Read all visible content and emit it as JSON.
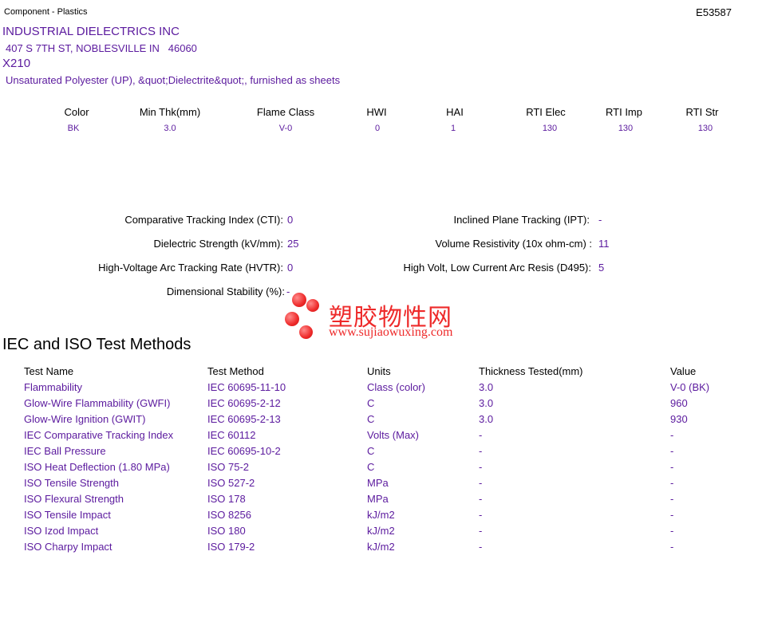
{
  "header": {
    "category": "Component - Plastics",
    "file_number": "E53587",
    "company": "INDUSTRIAL DIELECTRICS INC",
    "address": "407 S 7TH ST, NOBLESVILLE IN   46060",
    "grade": "X210",
    "description": "Unsaturated Polyester (UP), &quot;Dielectrite&quot;, furnished as sheets"
  },
  "summary": {
    "headers": [
      "Color",
      "Min Thk(mm)",
      "Flame Class",
      "HWI",
      "HAI",
      "RTI Elec",
      "RTI Imp",
      "RTI Str"
    ],
    "values": [
      "BK",
      "3.0",
      "V-0",
      "0",
      "1",
      "130",
      "130",
      "130"
    ]
  },
  "properties": {
    "cti_label": "Comparative Tracking Index (CTI):",
    "cti_value": "0",
    "ipt_label": "Inclined Plane Tracking (IPT):",
    "ipt_value": "-",
    "ds_label": "Dielectric Strength (kV/mm):",
    "ds_value": "25",
    "vr_label": "Volume Resistivity (10x ohm-cm) :",
    "vr_value": "11",
    "hvtr_label": "High-Voltage Arc Tracking Rate (HVTR):",
    "hvtr_value": "0",
    "d495_label": "High Volt, Low Current Arc Resis (D495):",
    "d495_value": "5",
    "dim_label": "Dimensional Stability (%):",
    "dim_value": "-"
  },
  "watermark": {
    "cn_text": "塑胶物性网",
    "url_text": "www.sujiaowuxing.com",
    "color": "#ee2a2a"
  },
  "test_section": {
    "title": "IEC and ISO Test Methods",
    "columns": [
      "Test Name",
      "Test Method",
      "Units",
      "Thickness Tested(mm)",
      "Value"
    ],
    "rows": [
      [
        "Flammability",
        "IEC 60695-11-10",
        "Class (color)",
        "3.0",
        "V-0 (BK)"
      ],
      [
        "Glow-Wire Flammability (GWFI)",
        "IEC 60695-2-12",
        "C",
        "3.0",
        "960"
      ],
      [
        "Glow-Wire Ignition (GWIT)",
        "IEC 60695-2-13",
        "C",
        "3.0",
        "930"
      ],
      [
        "IEC Comparative Tracking Index",
        "IEC 60112",
        "Volts (Max)",
        "-",
        "-"
      ],
      [
        "IEC Ball Pressure",
        "IEC 60695-10-2",
        "C",
        "-",
        "-"
      ],
      [
        "ISO Heat Deflection (1.80 MPa)",
        "ISO 75-2",
        "C",
        "-",
        "-"
      ],
      [
        "ISO Tensile Strength",
        "ISO 527-2",
        "MPa",
        "-",
        "-"
      ],
      [
        "ISO Flexural Strength",
        "ISO 178",
        "MPa",
        "-",
        "-"
      ],
      [
        "ISO Tensile Impact",
        "ISO 8256",
        "kJ/m2",
        "-",
        "-"
      ],
      [
        "ISO Izod Impact",
        "ISO 180",
        "kJ/m2",
        "-",
        "-"
      ],
      [
        "ISO Charpy Impact",
        "ISO 179-2",
        "kJ/m2",
        "-",
        "-"
      ]
    ]
  },
  "colors": {
    "accent": "#5b1a9e"
  }
}
